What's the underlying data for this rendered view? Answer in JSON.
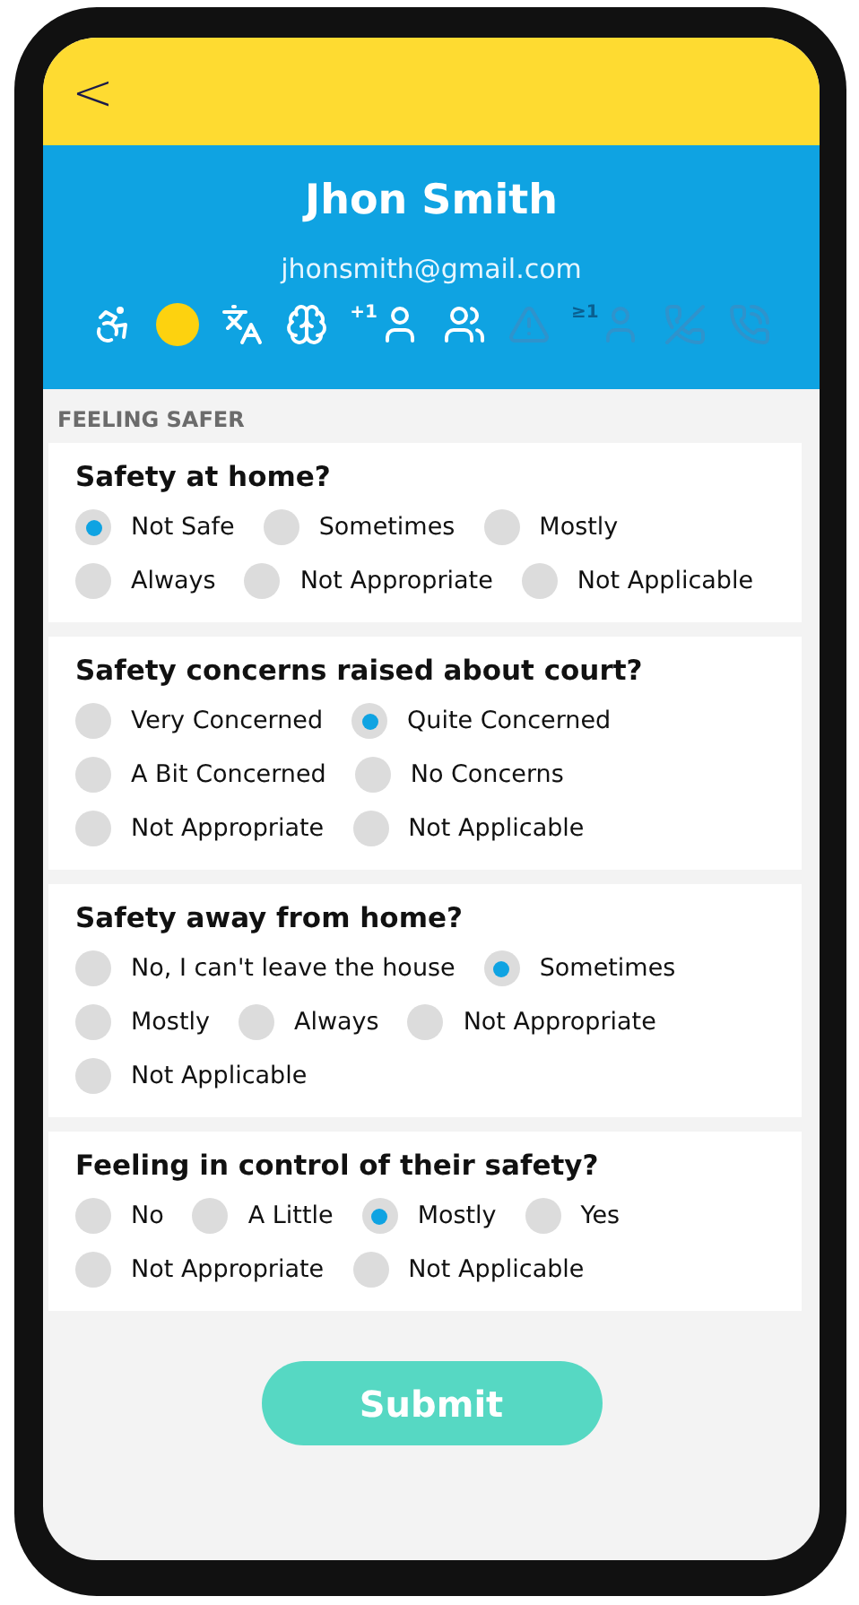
{
  "header": {
    "back": "<"
  },
  "profile": {
    "name": "Jhon Smith",
    "email": "jhonsmith@gmail.com",
    "icons": [
      {
        "kind": "wheelchair",
        "active": true
      },
      {
        "kind": "dot",
        "active": true,
        "color": "#fdd20f"
      },
      {
        "kind": "language",
        "active": true
      },
      {
        "kind": "head",
        "active": true
      },
      {
        "kind": "person",
        "active": true,
        "badge": "+1"
      },
      {
        "kind": "meeting",
        "active": true
      },
      {
        "kind": "warning",
        "active": false
      },
      {
        "kind": "person",
        "active": false,
        "badge": "≥1"
      },
      {
        "kind": "phone-off",
        "active": false
      },
      {
        "kind": "phone-call",
        "active": false
      }
    ]
  },
  "section": "FEELING SAFER",
  "questions": [
    {
      "title": "Safety at home?",
      "options": [
        {
          "label": "Not Safe",
          "selected": true
        },
        {
          "label": "Sometimes",
          "selected": false
        },
        {
          "label": "Mostly",
          "selected": false
        },
        {
          "label": "Always",
          "selected": false
        },
        {
          "label": "Not Appropriate",
          "selected": false
        },
        {
          "label": "Not Applicable",
          "selected": false
        }
      ]
    },
    {
      "title": "Safety concerns raised about court?",
      "options": [
        {
          "label": "Very Concerned",
          "selected": false
        },
        {
          "label": "Quite Concerned",
          "selected": true
        },
        {
          "label": "A Bit Concerned",
          "selected": false
        },
        {
          "label": "No Concerns",
          "selected": false
        },
        {
          "label": "Not Appropriate",
          "selected": false
        },
        {
          "label": "Not Applicable",
          "selected": false
        }
      ]
    },
    {
      "title": "Safety away from home?",
      "options": [
        {
          "label": "No, I can't leave the house",
          "selected": false
        },
        {
          "label": "Sometimes",
          "selected": true
        },
        {
          "label": "Mostly",
          "selected": false
        },
        {
          "label": "Always",
          "selected": false
        },
        {
          "label": "Not Appropriate",
          "selected": false
        },
        {
          "label": "Not Applicable",
          "selected": false
        }
      ]
    },
    {
      "title": "Feeling in control of their safety?",
      "options": [
        {
          "label": "No",
          "selected": false
        },
        {
          "label": "A Little",
          "selected": false
        },
        {
          "label": "Mostly",
          "selected": true
        },
        {
          "label": "Yes",
          "selected": false
        },
        {
          "label": "Not Appropriate",
          "selected": false
        },
        {
          "label": "Not Applicable",
          "selected": false
        }
      ]
    }
  ],
  "submit": "Submit"
}
